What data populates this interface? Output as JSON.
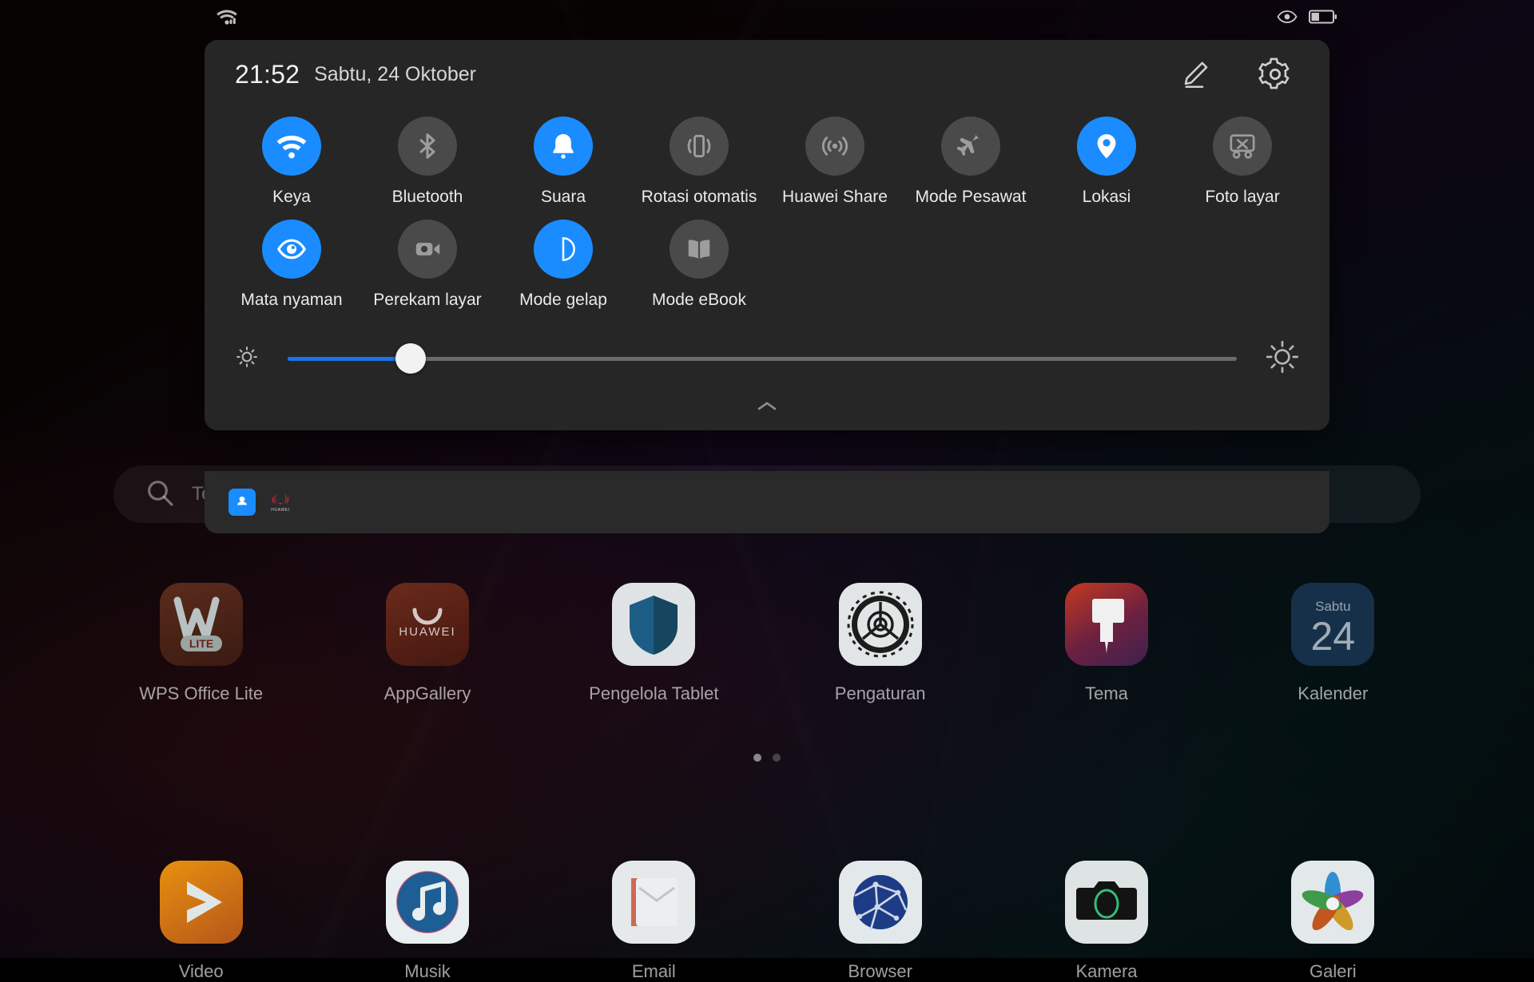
{
  "status_bar": {
    "left_icons": [
      "wifi-signal-icon"
    ],
    "right_icons": [
      "eye-comfort-icon",
      "battery-icon"
    ],
    "battery_level_percent": 35
  },
  "quick_settings": {
    "time": "21:52",
    "date": "Sabtu, 24 Oktober",
    "header_actions": [
      {
        "name": "edit-icon",
        "label": "Edit"
      },
      {
        "name": "gear-icon",
        "label": "Pengaturan"
      }
    ],
    "toggles": [
      {
        "label": "Keya",
        "icon": "wifi-icon",
        "on": true
      },
      {
        "label": "Bluetooth",
        "icon": "bluetooth-icon",
        "on": false
      },
      {
        "label": "Suara",
        "icon": "bell-icon",
        "on": true
      },
      {
        "label": "Rotasi otomatis",
        "icon": "auto-rotate-icon",
        "on": false
      },
      {
        "label": "Huawei Share",
        "icon": "huawei-share-icon",
        "on": false
      },
      {
        "label": "Mode Pesawat",
        "icon": "airplane-icon",
        "on": false
      },
      {
        "label": "Lokasi",
        "icon": "location-pin-icon",
        "on": true
      },
      {
        "label": "Foto layar",
        "icon": "screenshot-scissors-icon",
        "on": false
      },
      {
        "label": "Mata nyaman",
        "icon": "eye-icon",
        "on": true
      },
      {
        "label": "Perekam layar",
        "icon": "screen-record-icon",
        "on": false
      },
      {
        "label": "Mode gelap",
        "icon": "dark-mode-icon",
        "on": true
      },
      {
        "label": "Mode eBook",
        "icon": "book-icon",
        "on": false
      }
    ],
    "brightness": {
      "value_percent": 13,
      "low_icon": "brightness-low-icon",
      "high_icon": "brightness-high-icon"
    },
    "collapse_handle": "chevron-up-icon",
    "accent_color": "#1a8cff",
    "panel_color": "#262626"
  },
  "notification_shelf": {
    "apps": [
      {
        "name": "huawei-mobile-services-icon"
      },
      {
        "name": "huawei-logo-icon",
        "label": "HUAWEI"
      }
    ]
  },
  "search": {
    "icon": "search-icon",
    "placeholder": "Te"
  },
  "home_screen": {
    "rows": [
      [
        {
          "label": "WPS Office Lite",
          "icon": "wps-office-lite-icon",
          "badge": "LITE"
        },
        {
          "label": "AppGallery",
          "icon": "appgallery-icon",
          "badge": "HUAWEI"
        },
        {
          "label": "Pengelola Tablet",
          "icon": "tablet-manager-shield-icon"
        },
        {
          "label": "Pengaturan",
          "icon": "settings-gear-icon"
        },
        {
          "label": "Tema",
          "icon": "themes-brush-icon"
        },
        {
          "label": "Kalender",
          "icon": "calendar-icon",
          "day_name": "Sabtu",
          "day_number": "24"
        }
      ],
      [
        {
          "label": "Video",
          "icon": "video-play-icon"
        },
        {
          "label": "Musik",
          "icon": "music-note-icon"
        },
        {
          "label": "Email",
          "icon": "email-icon"
        },
        {
          "label": "Browser",
          "icon": "browser-globe-icon"
        },
        {
          "label": "Kamera",
          "icon": "camera-icon"
        },
        {
          "label": "Galeri",
          "icon": "gallery-flower-icon"
        }
      ]
    ],
    "page_dots": {
      "count": 2,
      "active_index": 0
    }
  }
}
